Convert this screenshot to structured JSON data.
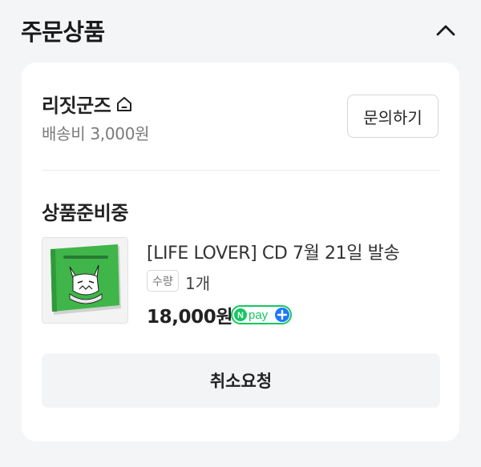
{
  "section": {
    "title": "주문상품"
  },
  "store": {
    "name": "리짓군즈",
    "shipping_fee": "배송비 3,000원",
    "inquiry_label": "문의하기"
  },
  "order": {
    "status": "상품준비중",
    "product": {
      "name": "[LIFE LOVER] CD 7월 21일 발송",
      "quantity_label": "수량",
      "quantity_value": "1개",
      "price": "18,000원",
      "pay_badge": "pay"
    },
    "cancel_label": "취소요청"
  },
  "colors": {
    "npay_green": "#14c75f",
    "npay_plus_blue": "#1e78ff",
    "album_green": "#3fb54a"
  },
  "icons": {
    "collapse": "chevron-up-icon",
    "store": "home-icon",
    "pay": "npay-icon"
  }
}
